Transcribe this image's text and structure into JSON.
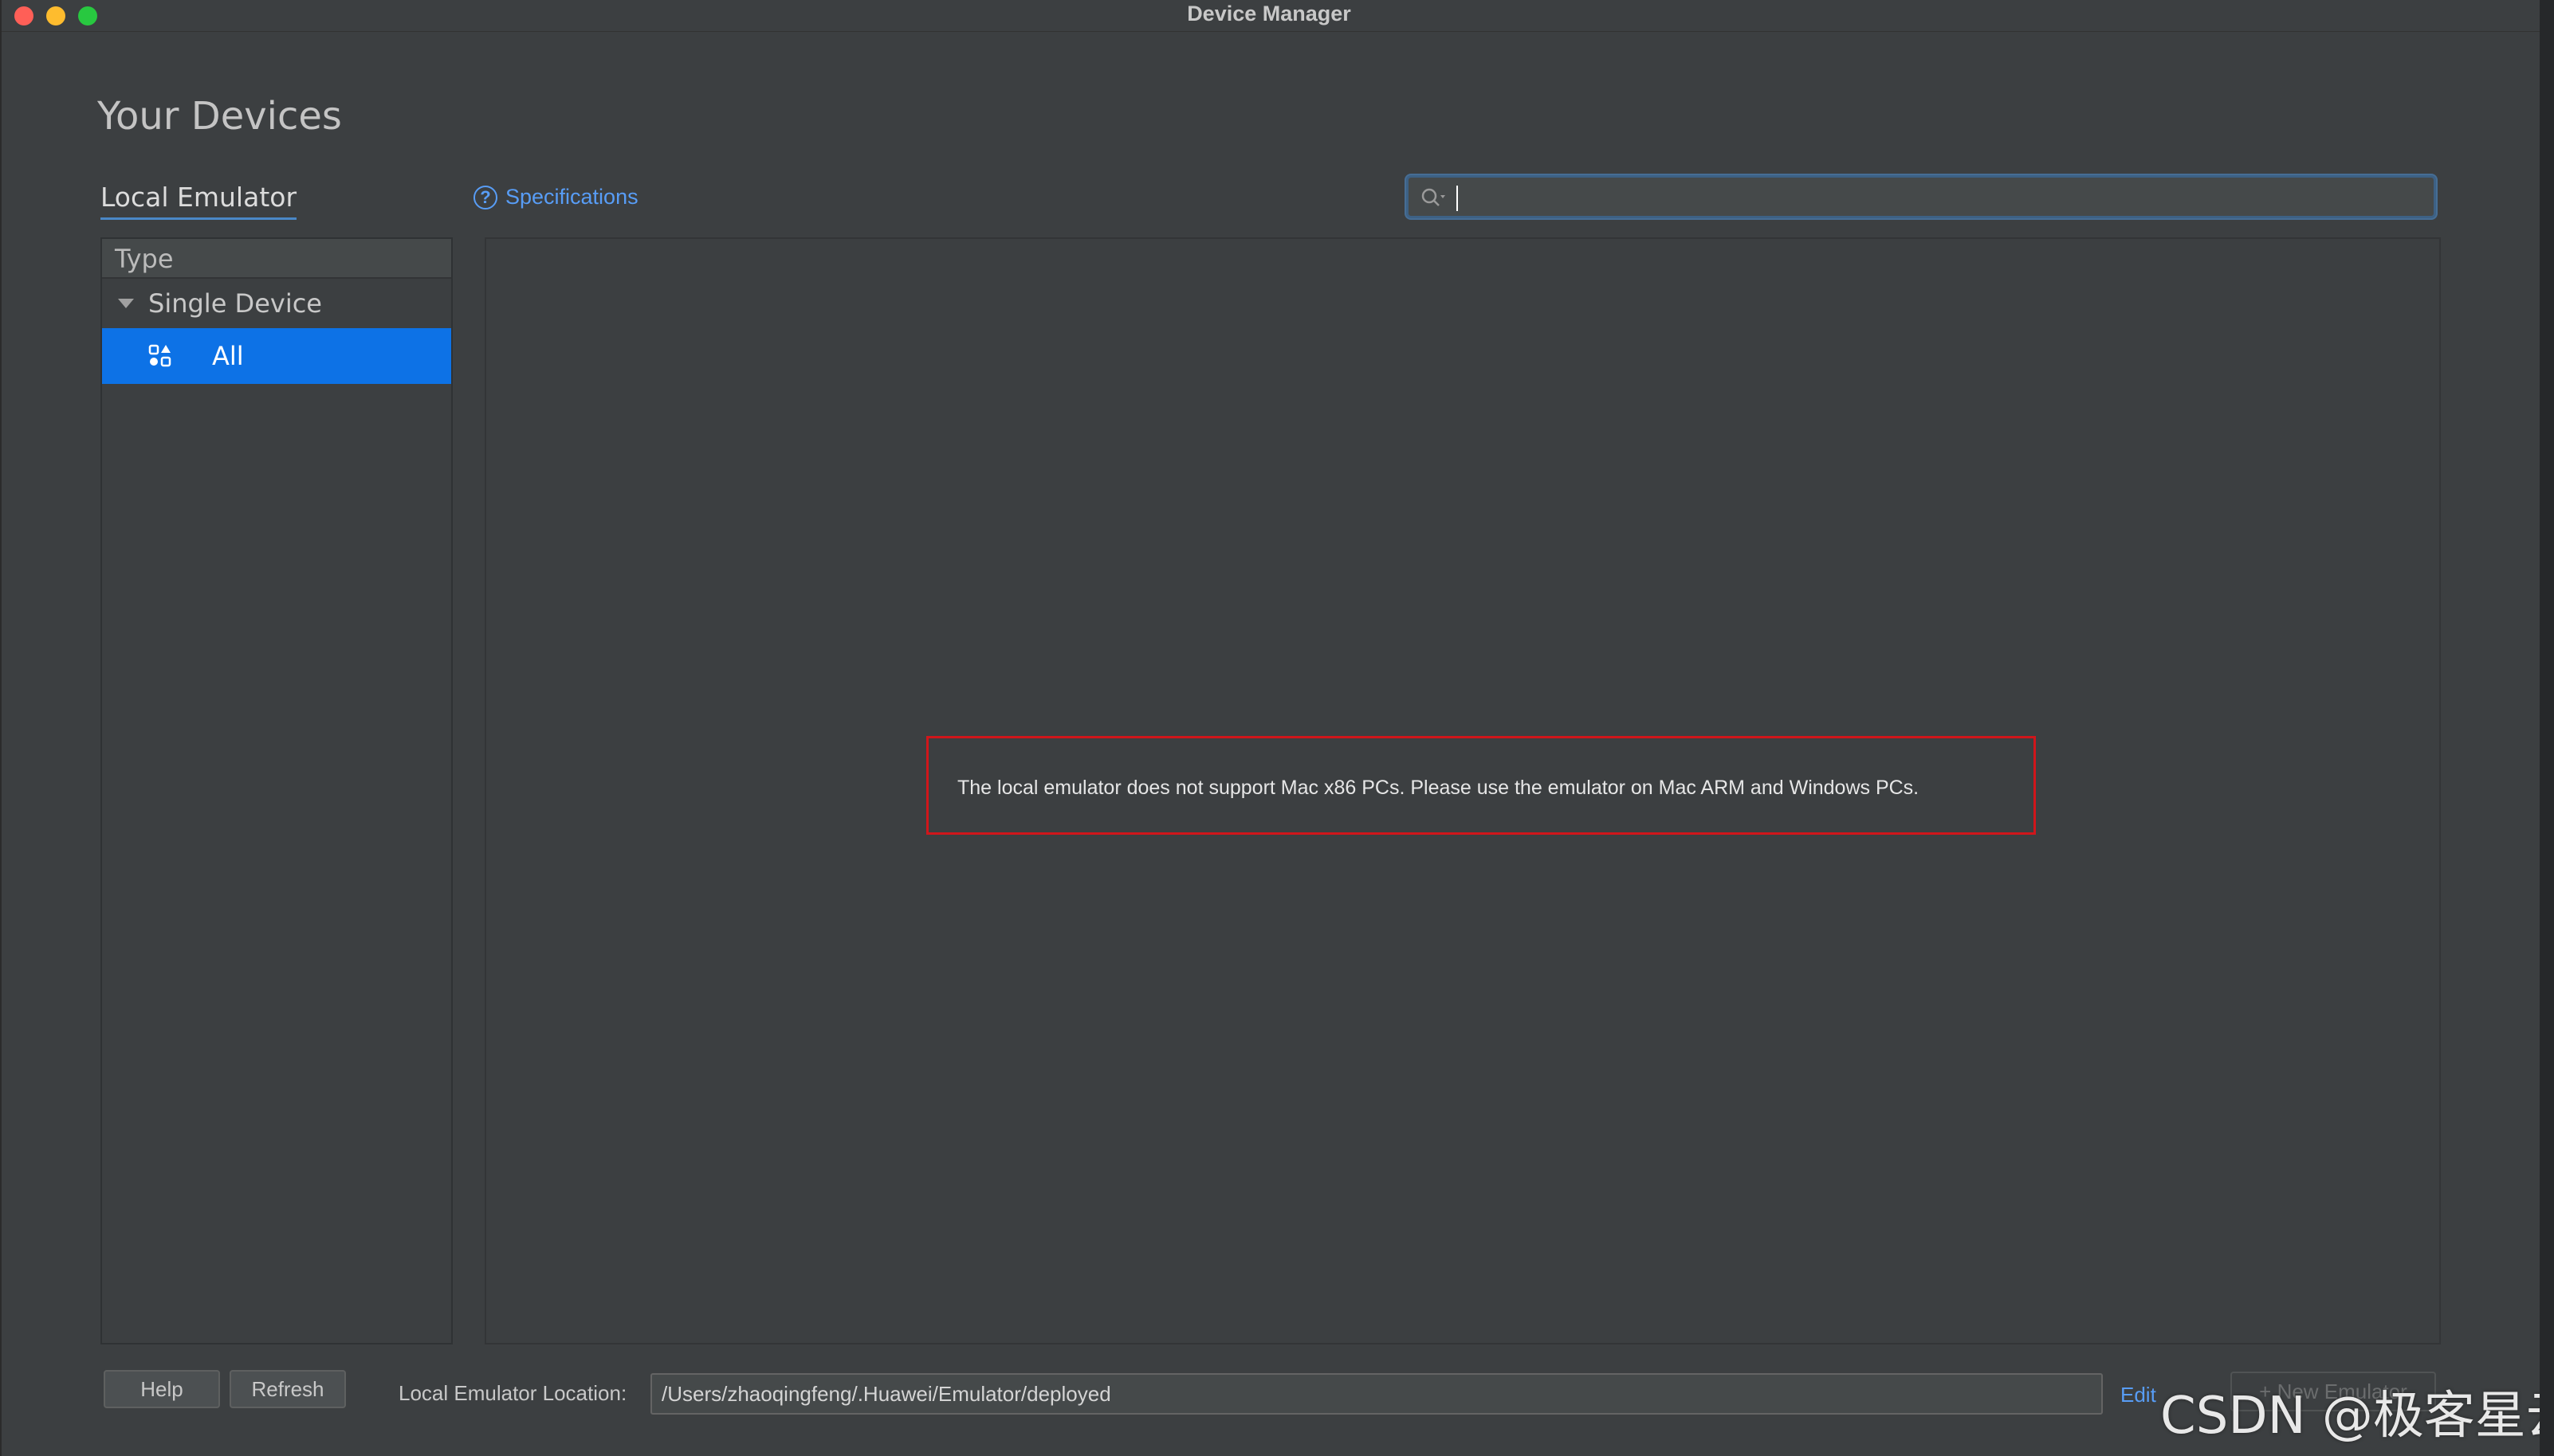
{
  "window": {
    "title": "Device Manager"
  },
  "page": {
    "heading": "Your Devices"
  },
  "tabs": {
    "local_emulator": "Local Emulator"
  },
  "specifications_link": {
    "label": "Specifications",
    "icon_glyph": "?"
  },
  "search": {
    "value": "",
    "placeholder": ""
  },
  "sidebar": {
    "header": "Type",
    "group_label": "Single Device",
    "selected_item": "All"
  },
  "content": {
    "message": "The local emulator does not support Mac x86 PCs. Please use the emulator on Mac ARM and Windows PCs."
  },
  "footer": {
    "help_label": "Help",
    "refresh_label": "Refresh",
    "location_label": "Local Emulator Location:",
    "location_value": "/Users/zhaoqingfeng/.Huawei/Emulator/deployed",
    "edit_label": "Edit",
    "new_emulator_label": "+ New Emulator"
  },
  "watermark": {
    "text": "CSDN @极客星云"
  },
  "colors": {
    "accent": "#0d72e6",
    "link": "#589df6",
    "error_border": "#d0161b",
    "background": "#3c3f41"
  }
}
